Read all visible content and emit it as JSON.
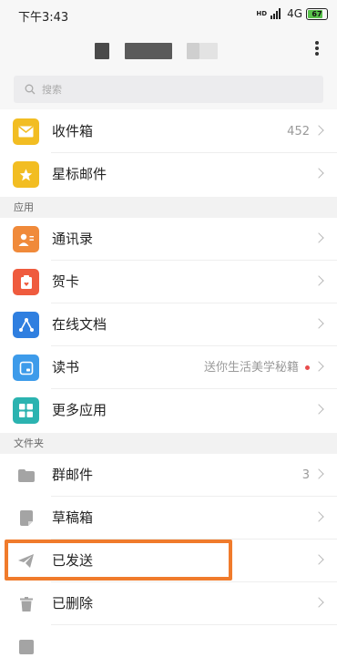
{
  "status_bar": {
    "time": "下午3:43",
    "network": "4G",
    "hd": "HD",
    "battery": "67"
  },
  "search": {
    "placeholder": "搜索"
  },
  "mailboxes": [
    {
      "label": "收件箱",
      "meta": "452",
      "icon": "inbox-icon",
      "color": "#f2bd22"
    },
    {
      "label": "星标邮件",
      "meta": "",
      "icon": "star-icon",
      "color": "#f2bd22"
    }
  ],
  "apps_section": {
    "title": "应用",
    "items": [
      {
        "label": "通讯录",
        "meta": "",
        "icon": "contacts-icon",
        "color": "#f08a3a"
      },
      {
        "label": "贺卡",
        "meta": "",
        "icon": "greeting-card-icon",
        "color": "#ef5b3e"
      },
      {
        "label": "在线文档",
        "meta": "",
        "icon": "online-docs-icon",
        "color": "#2f7fe0"
      },
      {
        "label": "读书",
        "meta": "送你生活美学秘籍",
        "icon": "reading-icon",
        "color": "#3d9bea"
      },
      {
        "label": "更多应用",
        "meta": "",
        "icon": "more-apps-icon",
        "color": "#2bb3b0"
      }
    ]
  },
  "folders_section": {
    "title": "文件夹",
    "items": [
      {
        "label": "群邮件",
        "meta": "3",
        "icon": "group-mail-icon",
        "color": "#a4a4a4"
      },
      {
        "label": "草稿箱",
        "meta": "",
        "icon": "drafts-icon",
        "color": "#a4a4a4"
      },
      {
        "label": "已发送",
        "meta": "",
        "icon": "sent-icon",
        "color": "#a4a4a4"
      },
      {
        "label": "已删除",
        "meta": "",
        "icon": "trash-icon",
        "color": "#a4a4a4"
      }
    ]
  },
  "colors": {
    "highlight": "#f07b2c",
    "unread_dot": "#e84c4c"
  }
}
